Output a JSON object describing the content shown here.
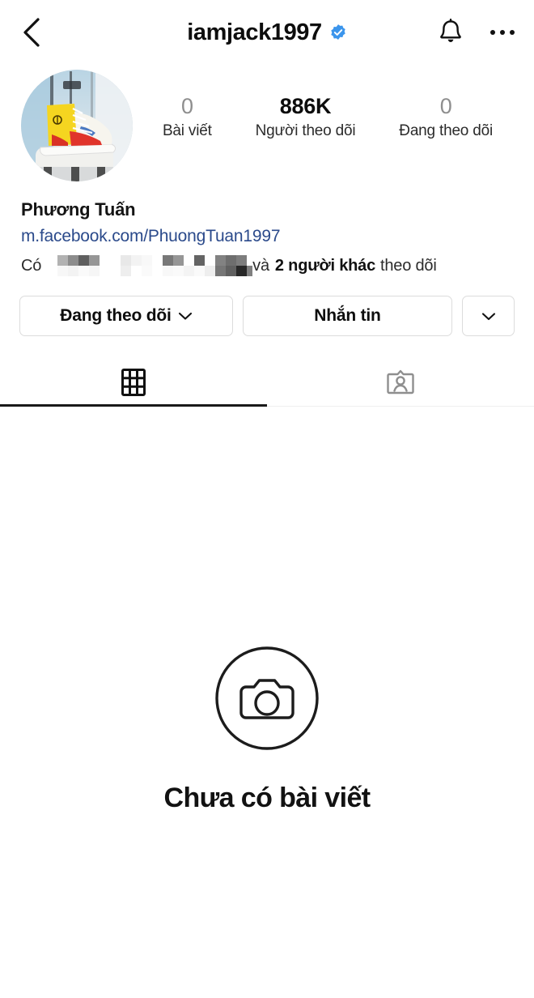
{
  "header": {
    "back_icon": "chevron-left-icon",
    "username": "iamjack1997",
    "verified_icon": "verified-badge-icon",
    "notifications_icon": "bell-icon",
    "menu_icon": "more-options-icon",
    "verified_color": "#3b95ec"
  },
  "profile": {
    "avatar_alt": "profile-picture-sneaker",
    "full_name": "Phương Tuấn",
    "link": "m.facebook.com/PhuongTuan1997",
    "link_color": "#2b4a8b"
  },
  "stats": [
    {
      "value": "0",
      "label": "Bài viết",
      "muted": true
    },
    {
      "value": "886K",
      "label": "Người theo dõi",
      "muted": false
    },
    {
      "value": "0",
      "label": "Đang theo dõi",
      "muted": true
    }
  ],
  "followed_by": {
    "prefix": "Có",
    "censored_names": "[redacted]",
    "conjunction": "và",
    "count_text": "2 người khác",
    "suffix": "theo dõi"
  },
  "actions": {
    "follow_label": "Đang theo dõi",
    "message_label": "Nhắn tin",
    "more_icon": "chevron-down-icon",
    "follow_chevron_icon": "chevron-down-icon"
  },
  "tabs": [
    {
      "name": "grid",
      "icon": "grid-icon",
      "active": true
    },
    {
      "name": "tagged",
      "icon": "tagged-person-icon",
      "active": false
    }
  ],
  "empty_state": {
    "icon": "camera-circle-icon",
    "title": "Chưa có bài viết"
  }
}
